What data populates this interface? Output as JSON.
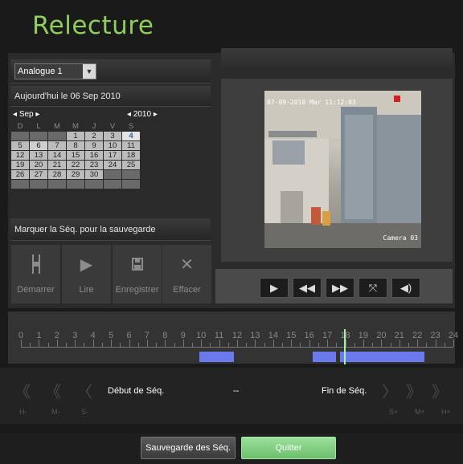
{
  "title": "Relecture",
  "camera_select": {
    "value": "Analogue 1"
  },
  "date_bar": "Aujourd'hui le 06 Sep 2010",
  "calendar": {
    "month": "Sep",
    "year": "2010",
    "weekdays": [
      "D",
      "L",
      "M",
      "M",
      "J",
      "V",
      "S"
    ],
    "weeks": [
      [
        "",
        "",
        "",
        "1",
        "2",
        "3",
        "4"
      ],
      [
        "5",
        "6",
        "7",
        "8",
        "9",
        "10",
        "11"
      ],
      [
        "12",
        "13",
        "14",
        "15",
        "16",
        "17",
        "18"
      ],
      [
        "19",
        "20",
        "21",
        "22",
        "23",
        "24",
        "25"
      ],
      [
        "26",
        "27",
        "28",
        "29",
        "30",
        "",
        ""
      ],
      [
        "",
        "",
        "",
        "",
        "",
        "",
        ""
      ]
    ],
    "today": "4",
    "selected": "6"
  },
  "mark_bar": "Marquer la Séq. pour la sauvegarde",
  "actions": [
    {
      "label": "Démarrer",
      "icon": "mark-start-icon"
    },
    {
      "label": "Lire",
      "icon": "play-icon"
    },
    {
      "label": "Enregistrer",
      "icon": "save-icon"
    },
    {
      "label": "Effacer",
      "icon": "delete-icon"
    }
  ],
  "video": {
    "timestamp": "07-09-2010 Mar 11:12:03",
    "camera_label": "Camera 03"
  },
  "playback_controls": [
    "play-icon",
    "rewind-icon",
    "fast-forward-icon",
    "fullscreen-icon",
    "volume-icon"
  ],
  "timeline": {
    "hours": [
      "0",
      "1",
      "2",
      "3",
      "4",
      "5",
      "6",
      "7",
      "8",
      "9",
      "10",
      "11",
      "12",
      "13",
      "14",
      "15",
      "16",
      "17",
      "18",
      "19",
      "20",
      "21",
      "22",
      "23",
      "24"
    ],
    "segments": [
      [
        9.9,
        11.8
      ],
      [
        16.2,
        17.5
      ],
      [
        17.7,
        22.4
      ]
    ],
    "cursor_hour": 17.95
  },
  "nav": {
    "left_labels": [
      "H-",
      "M-",
      "S-"
    ],
    "right_labels": [
      "S+",
      "M+",
      "H+"
    ],
    "start_label": "Début de Séq.",
    "separator": "--",
    "end_label": "Fin de Séq."
  },
  "footer": {
    "save_label": "Sauvegarde des Séq.",
    "quit_label": "Quitter"
  },
  "colors": {
    "title": "#8fce5c",
    "segment": "#6a7aec",
    "cursor": "#a8f0a8",
    "quit": "#7ec97e"
  }
}
